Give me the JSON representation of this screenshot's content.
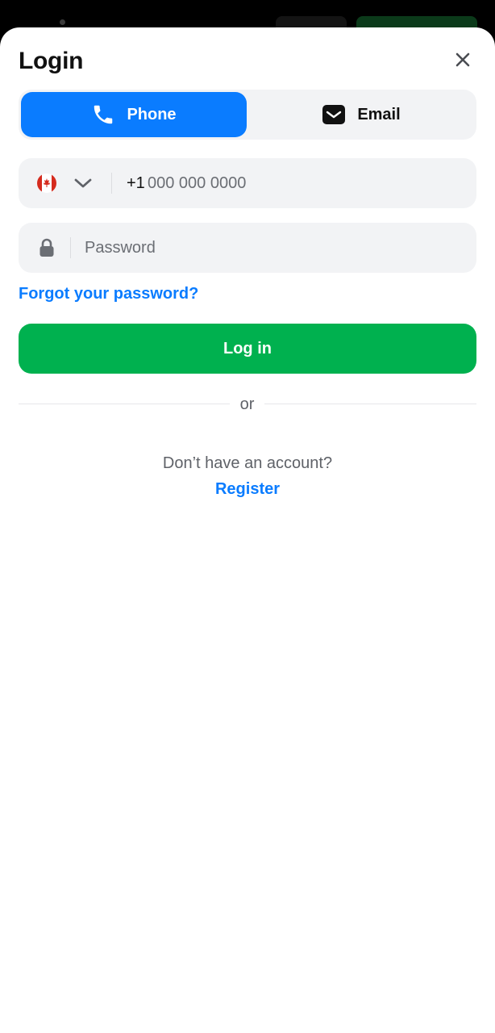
{
  "sheet": {
    "title": "Login",
    "close_icon": "close-icon"
  },
  "tabs": [
    {
      "label": "Phone",
      "icon": "phone-icon",
      "active": true
    },
    {
      "label": "Email",
      "icon": "email-icon",
      "active": false
    }
  ],
  "phone_field": {
    "country_flag": "canada-flag-icon",
    "dial_code": "+1",
    "placeholder": "000 000 0000",
    "value": ""
  },
  "password_field": {
    "icon": "lock-icon",
    "placeholder": "Password",
    "value": ""
  },
  "forgot_password_label": "Forgot your password?",
  "login_button_label": "Log in",
  "divider_label": "or",
  "footer": {
    "prompt": "Don’t have an account?",
    "register_label": "Register"
  },
  "colors": {
    "accent": "#0a7cff",
    "primary_button": "#00b14f",
    "field_background": "#f2f3f5",
    "flag_red": "#d52b1e"
  }
}
